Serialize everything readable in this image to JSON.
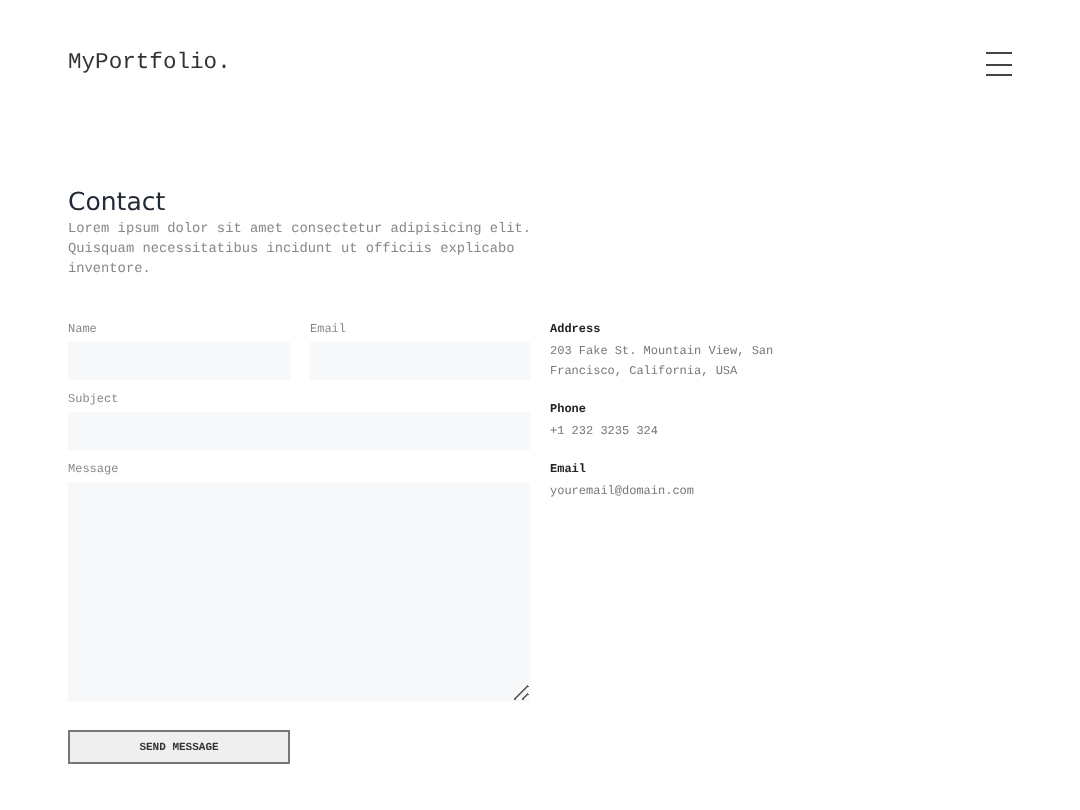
{
  "header": {
    "logo": "MyPortfolio."
  },
  "contact": {
    "title": "Contact",
    "intro": "Lorem ipsum dolor sit amet consectetur adipisicing elit. Quisquam necessitatibus incidunt ut officiis explicabo inventore."
  },
  "form": {
    "fields": [
      {
        "label": "Name",
        "kind": "text"
      },
      {
        "label": "Email",
        "kind": "text"
      },
      {
        "label": "Subject",
        "kind": "text"
      },
      {
        "label": "Message",
        "kind": "textarea"
      }
    ],
    "submit": "SEND MESSAGE"
  },
  "info": [
    {
      "heading": "Address",
      "text": "203 Fake St. Mountain View, San Francisco, California, USA"
    },
    {
      "heading": "Phone",
      "text": "+1 232 3235 324"
    },
    {
      "heading": "Email",
      "text": "youremail@domain.com"
    }
  ]
}
